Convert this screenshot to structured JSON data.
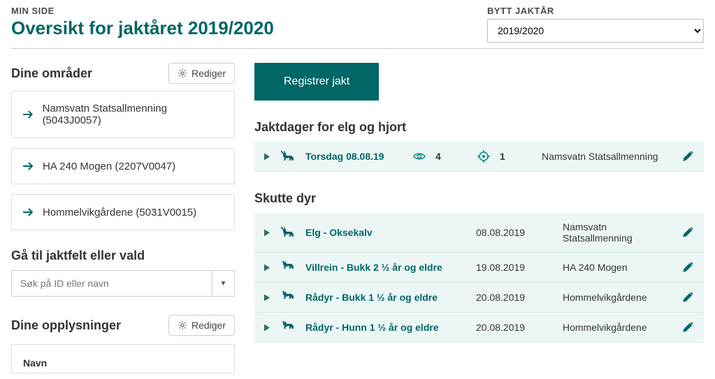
{
  "header": {
    "subtitle": "MIN SIDE",
    "title": "Oversikt for jaktåret 2019/2020",
    "year_label": "BYTT JAKTÅR",
    "year_selected": "2019/2020"
  },
  "sidebar": {
    "areas_title": "Dine områder",
    "edit_label": "Rediger",
    "areas": [
      {
        "label": "Namsvatn Statsallmenning (5043J0057)"
      },
      {
        "label": "HA 240 Mogen (2207V0047)"
      },
      {
        "label": "Hommelvikgårdene (5031V0015)"
      }
    ],
    "search_title": "Gå til jaktfelt eller vald",
    "search_placeholder": "Søk på ID eller navn",
    "details_title": "Dine opplysninger",
    "details_name_label": "Navn"
  },
  "main": {
    "register_label": "Registrer jakt",
    "hunt_days_title": "Jaktdager for elg og hjort",
    "hunt_days": [
      {
        "label": "Torsdag 08.08.19",
        "seen": "4",
        "shot": "1",
        "area": "Namsvatn Statsallmenning"
      }
    ],
    "shot_title": "Skutte dyr",
    "shot": [
      {
        "label": "Elg - Oksekalv",
        "date": "08.08.2019",
        "area": "Namsvatn Statsallmenning"
      },
      {
        "label": "Villrein - Bukk 2 ½ år og eldre",
        "date": "19.08.2019",
        "area": "HA 240 Mogen"
      },
      {
        "label": "Rådyr - Bukk 1 ½ år og eldre",
        "date": "20.08.2019",
        "area": "Hommelvikgårdene"
      },
      {
        "label": "Rådyr - Hunn 1 ½ år og eldre",
        "date": "20.08.2019",
        "area": "Hommelvikgårdene"
      }
    ]
  }
}
